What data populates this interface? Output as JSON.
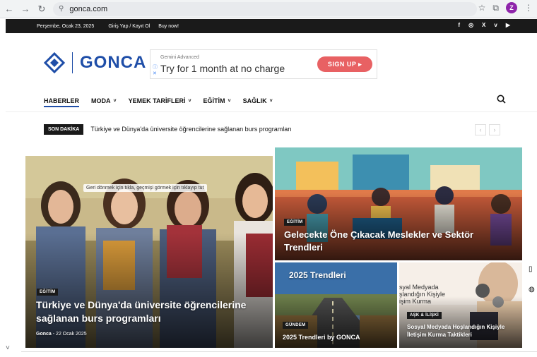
{
  "browser": {
    "url": "gonca.com",
    "back_icon": "arrow-left-icon",
    "forward_icon": "arrow-right-icon",
    "reload_icon": "reload-icon",
    "avatar_letter": "Z"
  },
  "topbar": {
    "date": "Perşembe, Ocak 23, 2025",
    "login": "Giriş Yap / Kayıt Ol",
    "buy": "Buy now!",
    "socials": [
      "f",
      "◎",
      "X",
      "v",
      "▶"
    ]
  },
  "logo": {
    "text": "GONCA",
    "color": "#1f4ea8"
  },
  "ad": {
    "sponsor": "Gemini Advanced",
    "headline": "Try for 1 month at no charge",
    "cta": "SIGN UP ▸",
    "cta_color": "#e86163"
  },
  "nav": {
    "items": [
      {
        "label": "HABERLER",
        "dropdown": false,
        "active": true
      },
      {
        "label": "MODA",
        "dropdown": true
      },
      {
        "label": "YEMEK TARİFLERİ",
        "dropdown": true
      },
      {
        "label": "EĞİTİM",
        "dropdown": true
      },
      {
        "label": "SAĞLIK",
        "dropdown": true
      }
    ],
    "chevron": "˅"
  },
  "breaking": {
    "badge": "SON DAKİKA",
    "text": "Türkiye ve Dünya'da üniversite öğrencilerine sağlanan burs programları"
  },
  "cards": {
    "main": {
      "category": "EĞİTİM",
      "title": "Türkiye ve Dünya'da üniversite öğrencilerine sağlanan burs programları",
      "author": "Gonca",
      "separator": "-",
      "date": "22 Ocak 2025",
      "tooltip": "Geri dönmek için tıkla, geçmişi görmek için tıklayıp tut"
    },
    "top_right": {
      "category": "EĞİTİM",
      "title": "Gelecekte Öne Çıkacak Meslekler ve Sektör Trendleri"
    },
    "bottom_left": {
      "category": "GÜNDEM",
      "title": "2025 Trendleri by GONCA",
      "image_text": "2025 Trendleri"
    },
    "bottom_right": {
      "category": "AŞK & İLİŞKİ",
      "title": "Sosyal Medyada Hoşlandığın Kişiyle İletişim Kurma Taktikleri",
      "image_text": "syal Medyada şlandığın Kişiyle işim Kurma"
    }
  }
}
